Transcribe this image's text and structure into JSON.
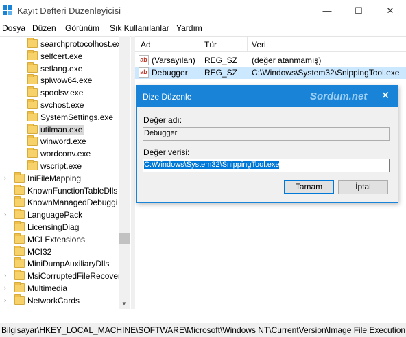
{
  "window": {
    "title": "Kayıt Defteri Düzenleyicisi",
    "minimize_glyph": "—",
    "maximize_glyph": "☐",
    "close_glyph": "✕"
  },
  "menu": [
    "Dosya",
    "Düzen",
    "Görünüm",
    "Sık Kullanılanlar",
    "Yardım"
  ],
  "tree": {
    "items": [
      {
        "label": "searchprotocolhost.exe",
        "expandable": false,
        "selected": false
      },
      {
        "label": "selfcert.exe",
        "expandable": false,
        "selected": false
      },
      {
        "label": "setlang.exe",
        "expandable": false,
        "selected": false
      },
      {
        "label": "splwow64.exe",
        "expandable": false,
        "selected": false
      },
      {
        "label": "spoolsv.exe",
        "expandable": false,
        "selected": false
      },
      {
        "label": "svchost.exe",
        "expandable": false,
        "selected": false
      },
      {
        "label": "SystemSettings.exe",
        "expandable": false,
        "selected": false
      },
      {
        "label": "utilman.exe",
        "expandable": false,
        "selected": true
      },
      {
        "label": "winword.exe",
        "expandable": false,
        "selected": false
      },
      {
        "label": "wordconv.exe",
        "expandable": false,
        "selected": false
      },
      {
        "label": "wscript.exe",
        "expandable": false,
        "selected": false
      },
      {
        "label": "IniFileMapping",
        "expandable": true,
        "selected": false
      },
      {
        "label": "KnownFunctionTableDlls",
        "expandable": false,
        "selected": false
      },
      {
        "label": "KnownManagedDebuggi",
        "expandable": false,
        "selected": false
      },
      {
        "label": "LanguagePack",
        "expandable": true,
        "selected": false
      },
      {
        "label": "LicensingDiag",
        "expandable": false,
        "selected": false
      },
      {
        "label": "MCI Extensions",
        "expandable": false,
        "selected": false
      },
      {
        "label": "MCI32",
        "expandable": false,
        "selected": false
      },
      {
        "label": "MiniDumpAuxiliaryDlls",
        "expandable": false,
        "selected": false
      },
      {
        "label": "MsiCorruptedFileRecover",
        "expandable": true,
        "selected": false
      },
      {
        "label": "Multimedia",
        "expandable": true,
        "selected": false
      },
      {
        "label": "NetworkCards",
        "expandable": true,
        "selected": false
      }
    ],
    "expander_glyph": "›"
  },
  "list": {
    "columns": [
      "Ad",
      "Tür",
      "Veri"
    ],
    "rows": [
      {
        "icon": "string-value-icon",
        "icon_text": "ab",
        "name": "(Varsayılan)",
        "type": "REG_SZ",
        "data": "(değer atanmamış)",
        "selected": false
      },
      {
        "icon": "string-value-icon",
        "icon_text": "ab",
        "name": "Debugger",
        "type": "REG_SZ",
        "data": "C:\\Windows\\System32\\SnippingTool.exe",
        "selected": true
      }
    ]
  },
  "dialog": {
    "title": "Dize Düzenle",
    "watermark": "Sordum.net",
    "close_glyph": "✕",
    "name_label": "Değer adı:",
    "name_value": "Debugger",
    "data_label": "Değer verisi:",
    "data_value": "C:\\Windows\\System32\\SnippingTool.exe",
    "ok_label": "Tamam",
    "cancel_label": "İptal"
  },
  "status": {
    "path": "Bilgisayar\\HKEY_LOCAL_MACHINE\\SOFTWARE\\Microsoft\\Windows NT\\CurrentVersion\\Image File Execution"
  },
  "colors": {
    "accent": "#1883d7",
    "selection": "#cce8ff",
    "folder": "#f7d26a"
  }
}
